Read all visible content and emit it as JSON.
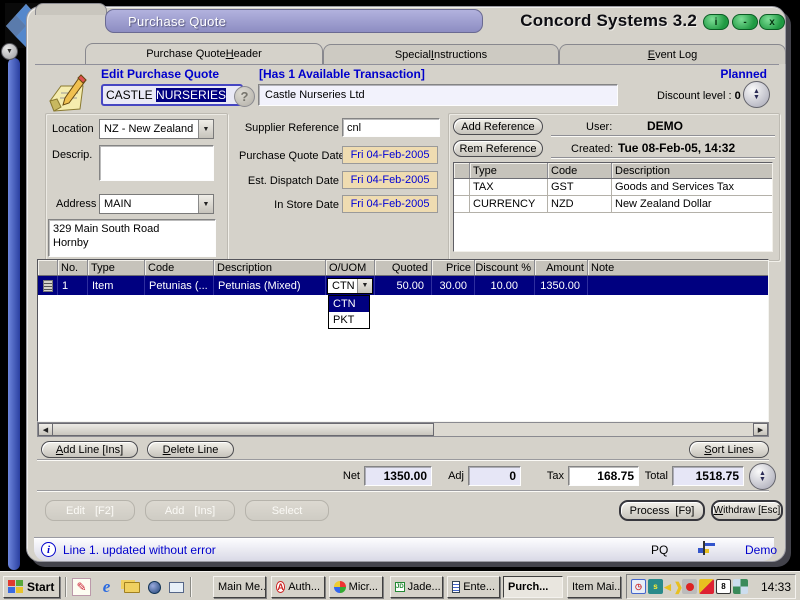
{
  "colors": {
    "selection_navy": "#000080",
    "link_blue": "#0000cc",
    "date_field_bg": "#efdcb1",
    "titlebar_lavender": "#9c9cd4",
    "window_button_green": "#2fae50",
    "window_gray": "#d5d2ca"
  },
  "titlebar": {
    "window_title": "Purchase Quote",
    "app_title": "Concord Systems 3.2",
    "info_glyph": "i",
    "minimize_glyph": "-",
    "close_glyph": "x"
  },
  "tabs": [
    {
      "pre": "Purchase Quote ",
      "key": "H",
      "post": "eader"
    },
    {
      "pre": "Special ",
      "key": "I",
      "post": "nstructions"
    },
    {
      "pre": "",
      "key": "E",
      "post": "vent Log"
    }
  ],
  "header": {
    "mode_label": "Edit Purchase Quote",
    "transaction_note": "[Has 1 Available Transaction]",
    "status": "Planned",
    "supplier_code_unselected": "CASTLE",
    "supplier_code_selected": "NURSERIES",
    "help_glyph": "?",
    "supplier_name": "Castle Nurseries Ltd",
    "discount_label": "Discount level :",
    "discount_value": "0"
  },
  "form": {
    "location_label": "Location",
    "location_value": "NZ - New Zealand",
    "descrip_label": "Descrip.",
    "descrip_value": "",
    "address_label": "Address",
    "address_value": "MAIN",
    "address_line1": "329 Main South Road",
    "address_line2": "Hornby",
    "supplier_ref_label": "Supplier Reference",
    "supplier_ref_value": "cnl",
    "quote_date_label": "Purchase Quote Date",
    "quote_date_value": "Fri 04-Feb-2005",
    "dispatch_date_label": "Est. Dispatch Date",
    "dispatch_date_value": "Fri 04-Feb-2005",
    "instore_date_label": "In Store Date",
    "instore_date_value": "Fri 04-Feb-2005"
  },
  "references": {
    "add_button": "Add Reference",
    "rem_button": "Rem Reference",
    "user_label": "User:",
    "user_value": "DEMO",
    "created_label": "Created:",
    "created_value": "Tue 08-Feb-05, 14:32",
    "columns": [
      "Type",
      "Code",
      "Description"
    ],
    "rows": [
      {
        "type": "TAX",
        "code": "GST",
        "description": "Goods and Services Tax"
      },
      {
        "type": "CURRENCY",
        "code": "NZD",
        "description": "New Zealand Dollar"
      }
    ]
  },
  "grid": {
    "columns": [
      "No.",
      "Type",
      "Code",
      "Description",
      "O/UOM",
      "Quoted",
      "Price",
      "Discount %",
      "Amount",
      "Note"
    ],
    "row": {
      "no": "1",
      "type": "Item",
      "code": "Petunias (...",
      "description": "Petunias (Mixed)",
      "ouom": "CTN",
      "quoted": "50.00",
      "price": "30.00",
      "discount": "10.00",
      "amount": "1350.00",
      "note": ""
    },
    "ouom_options": [
      "CTN",
      "PKT"
    ]
  },
  "line_buttons": {
    "add_key": "A",
    "add_rest": "dd Line [Ins]",
    "delete_key": "D",
    "delete_rest": "elete Line",
    "sort_key": "S",
    "sort_rest": "ort Lines"
  },
  "totals": {
    "net_label": "Net",
    "net_value": "1350.00",
    "adj_label": "Adj",
    "adj_value": "0",
    "tax_label": "Tax",
    "tax_value": "168.75",
    "total_label": "Total",
    "total_value": "1518.75"
  },
  "actions": {
    "edit_label": "Edit",
    "edit_key": "[F2]",
    "add_label": "Add",
    "add_key": "[Ins]",
    "select_label": "Select",
    "process_label": "Process",
    "process_key": "[F9]",
    "withdraw_key": "W",
    "withdraw_rest": "ithdraw [Esc]"
  },
  "statusbar": {
    "message": "Line 1. updated without error",
    "doc_code": "PQ",
    "user": "Demo"
  },
  "taskbar": {
    "start_label": "Start",
    "tasks": [
      {
        "label": "Main Me..."
      },
      {
        "label": "Auth..."
      },
      {
        "label": "Micr..."
      },
      {
        "label": "Jade..."
      },
      {
        "label": "Ente..."
      },
      {
        "label": "Purch..."
      },
      {
        "label": "Item Mai..."
      }
    ],
    "time": "14:33"
  }
}
